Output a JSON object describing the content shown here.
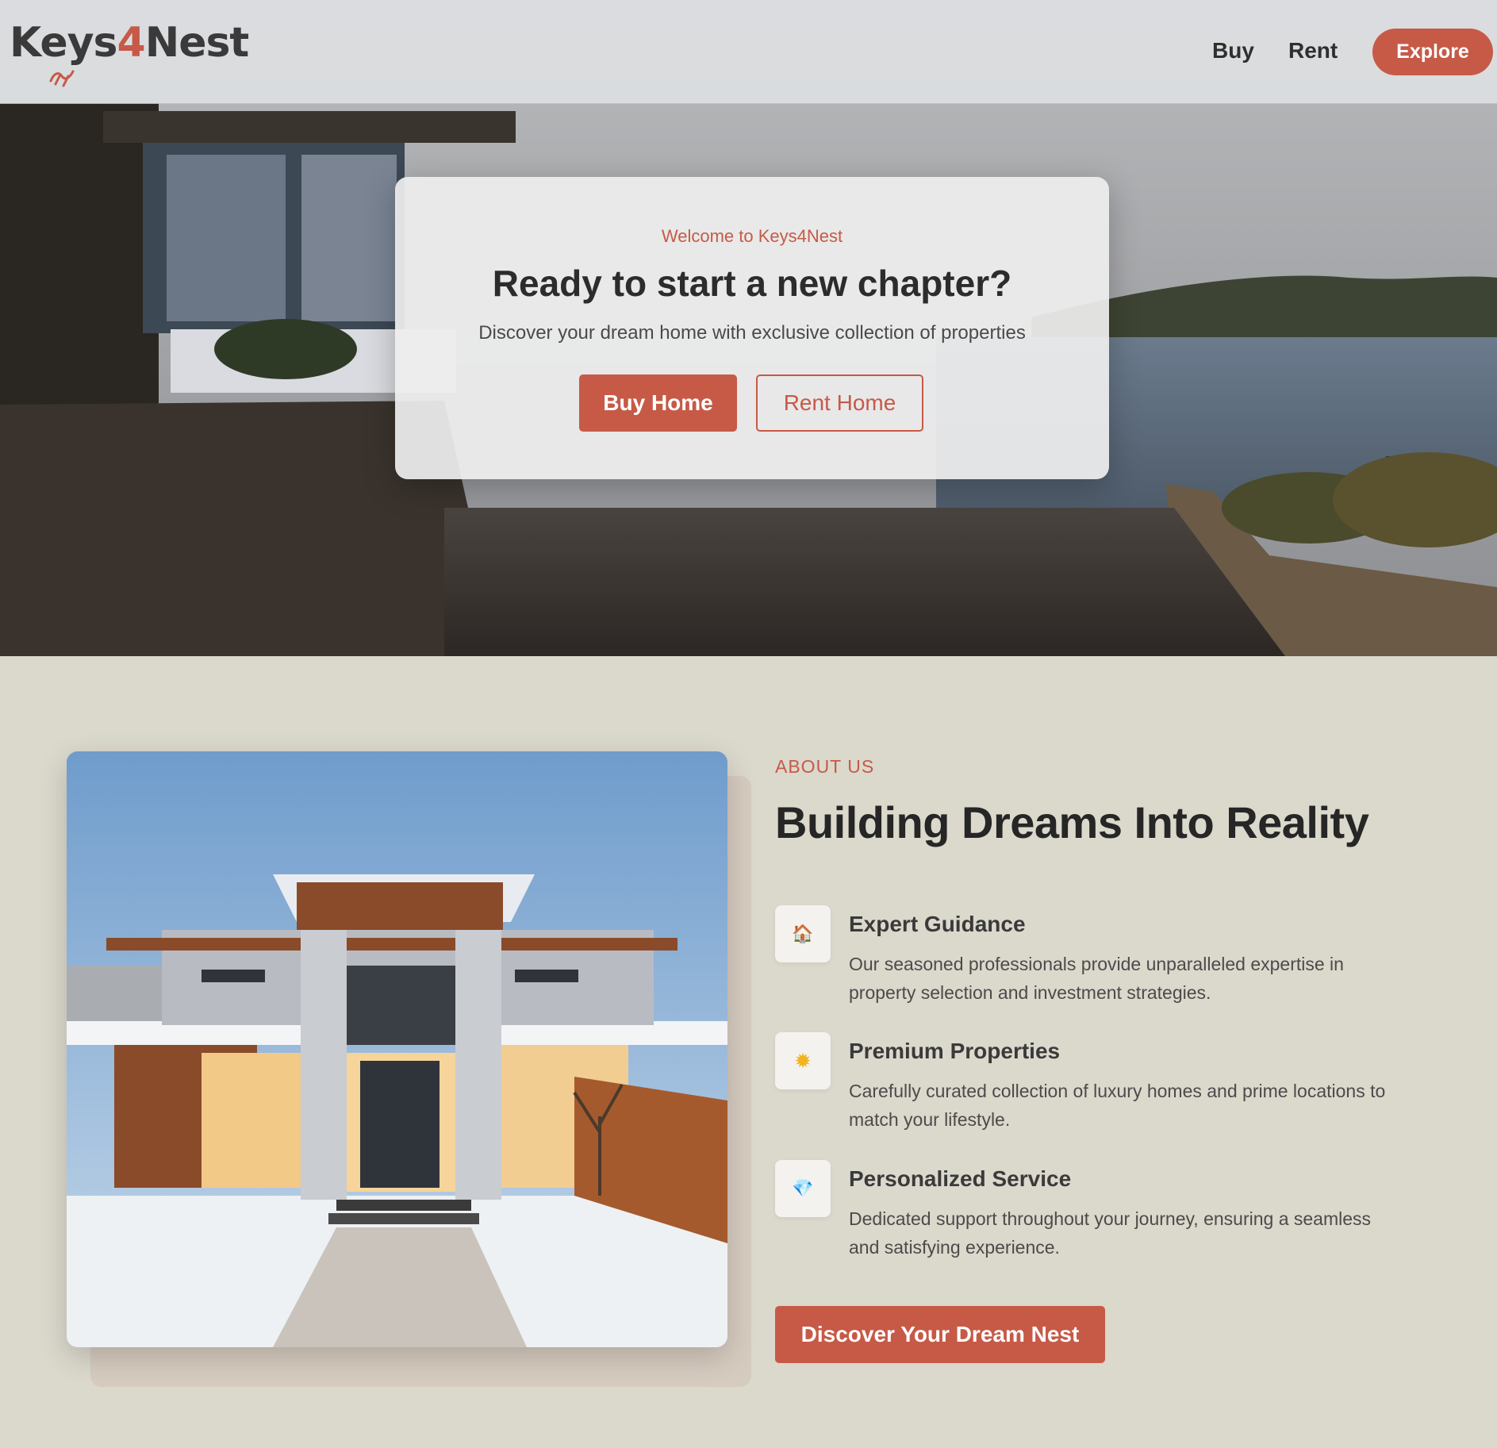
{
  "nav": {
    "logo_part1": "Keys",
    "logo_part2": "4",
    "logo_part3": "Nest",
    "buy_label": "Buy",
    "rent_label": "Rent",
    "explore_label": "Explore"
  },
  "hero": {
    "eyebrow": "Welcome to Keys4Nest",
    "title": "Ready to start a new chapter?",
    "subtitle": "Discover your dream home with exclusive collection of properties",
    "buy_button": "Buy Home",
    "rent_button": "Rent Home"
  },
  "about": {
    "eyebrow": "ABOUT US",
    "title": "Building Dreams Into Reality",
    "features": [
      {
        "icon": "house-icon",
        "glyph": "🏠",
        "title": "Expert Guidance",
        "description": "Our seasoned professionals provide unparalleled expertise in property selection and investment strategies."
      },
      {
        "icon": "star-icon",
        "glyph": "✹",
        "title": "Premium Properties",
        "description": "Carefully curated collection of luxury homes and prime locations to match your lifestyle."
      },
      {
        "icon": "diamond-icon",
        "glyph": "💎",
        "title": "Personalized Service",
        "description": "Dedicated support throughout your journey, ensuring a seamless and satisfying experience."
      }
    ],
    "cta_button": "Discover Your Dream Nest"
  },
  "colors": {
    "accent": "#c65a47",
    "page_background": "#dbd8cc",
    "text_dark": "#2b2b2b"
  }
}
